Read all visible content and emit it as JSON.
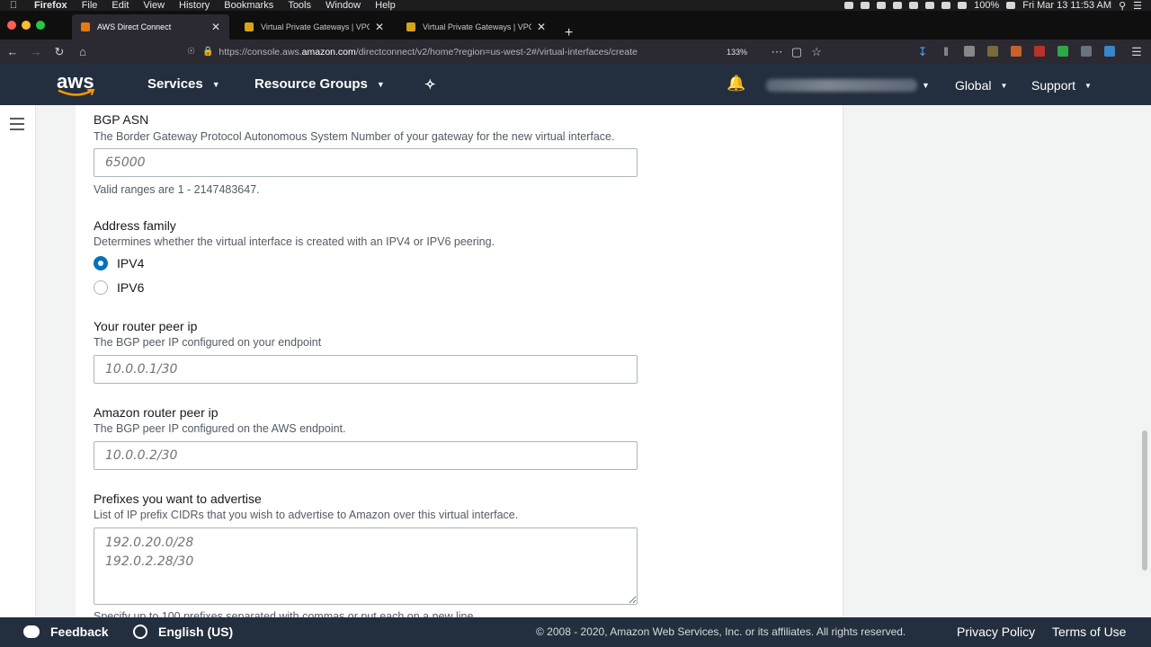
{
  "menubar": {
    "app": "Firefox",
    "items": [
      "File",
      "Edit",
      "View",
      "History",
      "Bookmarks",
      "Tools",
      "Window",
      "Help"
    ],
    "battery": "100%",
    "clock": "Fri Mar 13  11:53 AM"
  },
  "tabs": [
    {
      "title": "AWS Direct Connect",
      "active": true
    },
    {
      "title": "Virtual Private Gateways | VPC",
      "active": false
    },
    {
      "title": "Virtual Private Gateways | VPC",
      "active": false
    }
  ],
  "nav": {
    "url_prefix": "https://console.aws.",
    "url_domain": "amazon.com",
    "url_suffix": "/directconnect/v2/home?region=us-west-2#/virtual-interfaces/create",
    "zoom": "133%"
  },
  "aws_header": {
    "logo": "aws",
    "services": "Services",
    "resource_groups": "Resource Groups",
    "region": "Global",
    "support": "Support"
  },
  "form": {
    "bgp_asn": {
      "label": "BGP ASN",
      "description": "The Border Gateway Protocol Autonomous System Number of your gateway for the new virtual interface.",
      "placeholder": "65000",
      "value": "",
      "hint": "Valid ranges are 1 - 2147483647."
    },
    "address_family": {
      "label": "Address family",
      "description": "Determines whether the virtual interface is created with an IPV4 or IPV6 peering.",
      "options": [
        "IPV4",
        "IPV6"
      ],
      "selected": "IPV4"
    },
    "router_peer_ip": {
      "label": "Your router peer ip",
      "description": "The BGP peer IP configured on your endpoint",
      "placeholder": "10.0.0.1/30",
      "value": ""
    },
    "amazon_peer_ip": {
      "label": "Amazon router peer ip",
      "description": "The BGP peer IP configured on the AWS endpoint.",
      "placeholder": "10.0.0.2/30",
      "value": ""
    },
    "prefixes": {
      "label": "Prefixes you want to advertise",
      "description": "List of IP prefix CIDRs that you wish to advertise to Amazon over this virtual interface.",
      "placeholder": "192.0.20.0/28\n192.0.2.28/30",
      "value": "",
      "hint": "Specify up to 100 prefixes separated with commas or put each on a new line."
    }
  },
  "footer": {
    "feedback": "Feedback",
    "language": "English (US)",
    "copyright": "© 2008 - 2020, Amazon Web Services, Inc. or its affiliates. All rights reserved.",
    "privacy": "Privacy Policy",
    "terms": "Terms of Use"
  },
  "colors": {
    "aws_nav": "#232f3e",
    "radio_selected": "#0073bb",
    "aws_orange": "#ff9900"
  }
}
